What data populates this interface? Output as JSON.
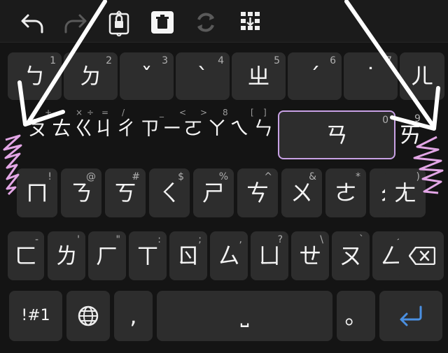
{
  "toolbar": {
    "items": [
      "undo-icon",
      "redo-icon",
      "keyboard-lock-icon",
      "trash-icon",
      "sync-icon",
      "keypad-icon"
    ]
  },
  "rows": {
    "row1": [
      {
        "main": "ㄅ",
        "sub": "1"
      },
      {
        "main": "ㄉ",
        "sub": "2"
      },
      {
        "main": "ˇ",
        "sub": "3"
      },
      {
        "main": "ˋ",
        "sub": "4"
      },
      {
        "main": "ㄓ",
        "sub": "5"
      },
      {
        "main": "ˊ",
        "sub": "6"
      },
      {
        "main": "˙",
        "sub": "7"
      },
      {
        "main": "ㄦ",
        "sub": ""
      }
    ],
    "row2_overlay": [
      "ㄆ",
      "ㄊ",
      "ㄍ",
      "ㄐ",
      "ㄔ",
      "ㄗ",
      "ㄧ",
      "ㄛ",
      "ㄚ",
      "ㄟ",
      "ㄣ"
    ],
    "row2_overlay_subs": [
      "+",
      "×",
      "÷",
      "=",
      "/",
      "_",
      "<",
      ">",
      "8",
      "[",
      "]"
    ],
    "row2_highlight": {
      "main": "ㄢ",
      "sub": "0"
    },
    "row2_right": {
      "main": "ㄞ",
      "sub": "9"
    },
    "row3": [
      {
        "main": "ㄇ",
        "sub": "!"
      },
      {
        "main": "ㄋ",
        "sub": "@"
      },
      {
        "main": "ㄎ",
        "sub": "#"
      },
      {
        "main": "ㄑ",
        "sub": "$"
      },
      {
        "main": "ㄕ",
        "sub": "%"
      },
      {
        "main": "ㄘ",
        "sub": "^"
      },
      {
        "main": "ㄨ",
        "sub": "&"
      },
      {
        "main": "ㄜ",
        "sub": "*"
      },
      {
        "main": "ㄠ",
        "sub": "("
      },
      {
        "main": "ㄤ",
        "sub": ")"
      }
    ],
    "row4": [
      {
        "main": "ㄈ",
        "sub": "-"
      },
      {
        "main": "ㄌ",
        "sub": "'"
      },
      {
        "main": "ㄏ",
        "sub": "\""
      },
      {
        "main": "ㄒ",
        "sub": ":"
      },
      {
        "main": "ㄖ",
        "sub": ";"
      },
      {
        "main": "ㄙ",
        "sub": ","
      },
      {
        "main": "ㄩ",
        "sub": "?"
      },
      {
        "main": "ㄝ",
        "sub": "\\"
      },
      {
        "main": "ㄡ",
        "sub": "`"
      },
      {
        "main": "ㄥ",
        "sub": "~"
      }
    ],
    "row5": {
      "symbols": "!#1",
      "comma": ",",
      "space": "⎵",
      "period": "。"
    }
  },
  "colors": {
    "highlight": "#c9a2e6",
    "enter": "#4a90e2",
    "scribble": "#e3a6e6"
  }
}
